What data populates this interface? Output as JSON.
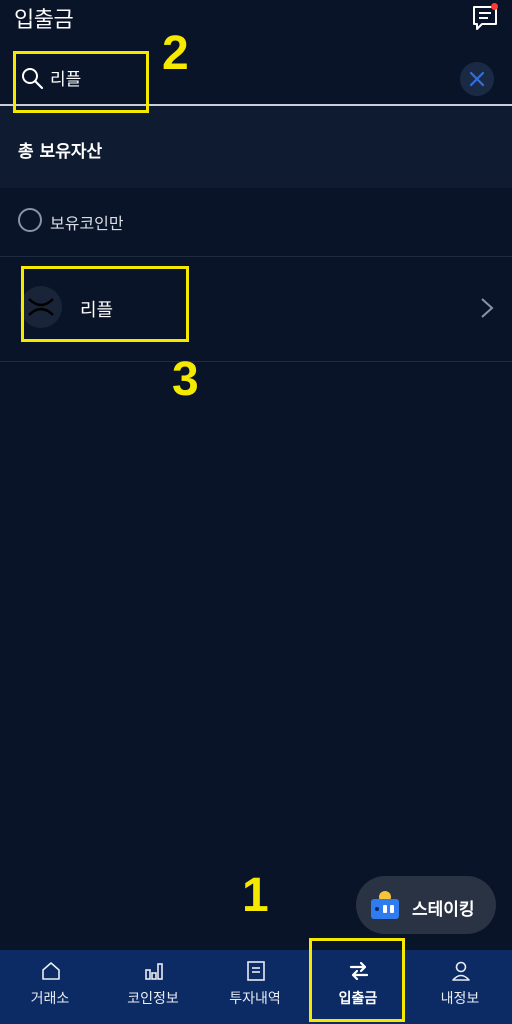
{
  "header": {
    "title": "입출금",
    "chat_icon": "chat-icon",
    "notification_color": "#ff3b30"
  },
  "search": {
    "value": "리플",
    "placeholder": ""
  },
  "total": {
    "label": "총 보유자산"
  },
  "filter": {
    "label": "보유코인만"
  },
  "coins": [
    {
      "name": "리플",
      "icon": "xrp-logo-icon"
    }
  ],
  "staking": {
    "label": "스테이킹"
  },
  "annotations": [
    "1",
    "2",
    "3"
  ],
  "nav": [
    {
      "label": "거래소",
      "icon": "home-icon"
    },
    {
      "label": "코인정보",
      "icon": "bar-chart-icon"
    },
    {
      "label": "투자내역",
      "icon": "document-icon"
    },
    {
      "label": "입출금",
      "icon": "transfer-arrows-icon",
      "active": true
    },
    {
      "label": "내정보",
      "icon": "user-icon"
    }
  ],
  "colors": {
    "background": "#0a1428",
    "nav_background": "#0c2a63",
    "annotation": "#f5e900",
    "clear_accent": "#2f6fe0"
  }
}
